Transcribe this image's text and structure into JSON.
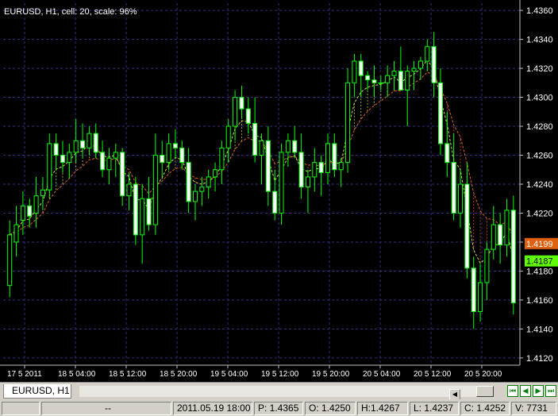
{
  "chart": {
    "header": "EURUSD, H1, cell: 20, scale: 96%",
    "background": "#000000",
    "grid_color": "#2f2f7f",
    "axis_color": "#c0c0c0",
    "bull_color": "#ffffff",
    "bear_color": "#00ff00",
    "price_labels": [
      "1.4360",
      "1.4340",
      "1.4320",
      "1.4300",
      "1.4280",
      "1.4260",
      "1.4240",
      "1.4220",
      "1.4200",
      "1.4180",
      "1.4160",
      "1.4140",
      "1.4120"
    ],
    "time_labels": [
      "17 5 2011",
      "18 5 04:00",
      "18 5 12:00",
      "18 5 20:00",
      "19 5 04:00",
      "19 5 12:00",
      "19 5 20:00",
      "20 5 04:00",
      "20 5 12:00",
      "20 5 20:00"
    ],
    "price_badges": [
      {
        "label": "1.4199",
        "bg": "#e06010",
        "fg": "#ffffff"
      },
      {
        "label": "1.4187",
        "bg": "#60ff00",
        "fg": "#000000"
      }
    ]
  },
  "chart_data": {
    "type": "candlestick",
    "symbol": "EURUSD",
    "timeframe": "H1",
    "ylim": [
      1.4115,
      1.4365
    ],
    "candles": [
      {
        "o": 1.417,
        "h": 1.4215,
        "l": 1.4162,
        "c": 1.4205
      },
      {
        "o": 1.42,
        "h": 1.4225,
        "l": 1.419,
        "c": 1.4212
      },
      {
        "o": 1.4215,
        "h": 1.4235,
        "l": 1.4205,
        "c": 1.4225
      },
      {
        "o": 1.4225,
        "h": 1.423,
        "l": 1.421,
        "c": 1.4218
      },
      {
        "o": 1.422,
        "h": 1.4245,
        "l": 1.421,
        "c": 1.4232
      },
      {
        "o": 1.4232,
        "h": 1.4245,
        "l": 1.4222,
        "c": 1.4236
      },
      {
        "o": 1.4236,
        "h": 1.4275,
        "l": 1.423,
        "c": 1.4268
      },
      {
        "o": 1.4268,
        "h": 1.4275,
        "l": 1.425,
        "c": 1.426
      },
      {
        "o": 1.426,
        "h": 1.427,
        "l": 1.4248,
        "c": 1.4255
      },
      {
        "o": 1.4255,
        "h": 1.4268,
        "l": 1.4244,
        "c": 1.4262
      },
      {
        "o": 1.4262,
        "h": 1.4285,
        "l": 1.4255,
        "c": 1.427
      },
      {
        "o": 1.427,
        "h": 1.4282,
        "l": 1.4258,
        "c": 1.4265
      },
      {
        "o": 1.4265,
        "h": 1.428,
        "l": 1.426,
        "c": 1.4275
      },
      {
        "o": 1.4275,
        "h": 1.4282,
        "l": 1.4258,
        "c": 1.4262
      },
      {
        "o": 1.4262,
        "h": 1.427,
        "l": 1.4245,
        "c": 1.425
      },
      {
        "o": 1.425,
        "h": 1.4265,
        "l": 1.424,
        "c": 1.4258
      },
      {
        "o": 1.4258,
        "h": 1.4268,
        "l": 1.4245,
        "c": 1.4262
      },
      {
        "o": 1.4262,
        "h": 1.4265,
        "l": 1.4225,
        "c": 1.4232
      },
      {
        "o": 1.4232,
        "h": 1.4248,
        "l": 1.4222,
        "c": 1.424
      },
      {
        "o": 1.424,
        "h": 1.4245,
        "l": 1.4198,
        "c": 1.4205
      },
      {
        "o": 1.4205,
        "h": 1.424,
        "l": 1.4185,
        "c": 1.423
      },
      {
        "o": 1.423,
        "h": 1.4245,
        "l": 1.4208,
        "c": 1.4212
      },
      {
        "o": 1.4212,
        "h": 1.4275,
        "l": 1.4205,
        "c": 1.426
      },
      {
        "o": 1.426,
        "h": 1.427,
        "l": 1.4245,
        "c": 1.4255
      },
      {
        "o": 1.4255,
        "h": 1.4275,
        "l": 1.425,
        "c": 1.4268
      },
      {
        "o": 1.4268,
        "h": 1.4278,
        "l": 1.4258,
        "c": 1.4265
      },
      {
        "o": 1.4265,
        "h": 1.427,
        "l": 1.425,
        "c": 1.4255
      },
      {
        "o": 1.4255,
        "h": 1.4265,
        "l": 1.422,
        "c": 1.4228
      },
      {
        "o": 1.4228,
        "h": 1.424,
        "l": 1.4215,
        "c": 1.4235
      },
      {
        "o": 1.4235,
        "h": 1.4245,
        "l": 1.4225,
        "c": 1.4238
      },
      {
        "o": 1.4238,
        "h": 1.425,
        "l": 1.423,
        "c": 1.4245
      },
      {
        "o": 1.4245,
        "h": 1.4255,
        "l": 1.4235,
        "c": 1.425
      },
      {
        "o": 1.425,
        "h": 1.427,
        "l": 1.424,
        "c": 1.4265
      },
      {
        "o": 1.4265,
        "h": 1.4285,
        "l": 1.4255,
        "c": 1.428
      },
      {
        "o": 1.428,
        "h": 1.4305,
        "l": 1.427,
        "c": 1.43
      },
      {
        "o": 1.43,
        "h": 1.4308,
        "l": 1.4285,
        "c": 1.4292
      },
      {
        "o": 1.4292,
        "h": 1.43,
        "l": 1.4275,
        "c": 1.4282
      },
      {
        "o": 1.4282,
        "h": 1.43,
        "l": 1.4255,
        "c": 1.426
      },
      {
        "o": 1.426,
        "h": 1.4275,
        "l": 1.424,
        "c": 1.427
      },
      {
        "o": 1.427,
        "h": 1.428,
        "l": 1.4225,
        "c": 1.4235
      },
      {
        "o": 1.4235,
        "h": 1.425,
        "l": 1.4215,
        "c": 1.422
      },
      {
        "o": 1.422,
        "h": 1.4268,
        "l": 1.4212,
        "c": 1.4262
      },
      {
        "o": 1.4262,
        "h": 1.4275,
        "l": 1.4252,
        "c": 1.427
      },
      {
        "o": 1.427,
        "h": 1.428,
        "l": 1.4258,
        "c": 1.4262
      },
      {
        "o": 1.4262,
        "h": 1.4275,
        "l": 1.423,
        "c": 1.4238
      },
      {
        "o": 1.4238,
        "h": 1.425,
        "l": 1.422,
        "c": 1.4245
      },
      {
        "o": 1.4245,
        "h": 1.4265,
        "l": 1.4235,
        "c": 1.4255
      },
      {
        "o": 1.4255,
        "h": 1.426,
        "l": 1.4232,
        "c": 1.4248
      },
      {
        "o": 1.4248,
        "h": 1.4275,
        "l": 1.424,
        "c": 1.4268
      },
      {
        "o": 1.4268,
        "h": 1.4275,
        "l": 1.4245,
        "c": 1.425
      },
      {
        "o": 1.425,
        "h": 1.4258,
        "l": 1.4238,
        "c": 1.4255
      },
      {
        "o": 1.4255,
        "h": 1.432,
        "l": 1.4248,
        "c": 1.431
      },
      {
        "o": 1.431,
        "h": 1.433,
        "l": 1.43,
        "c": 1.4325
      },
      {
        "o": 1.4325,
        "h": 1.433,
        "l": 1.43,
        "c": 1.4315
      },
      {
        "o": 1.4315,
        "h": 1.4318,
        "l": 1.4305,
        "c": 1.4312
      },
      {
        "o": 1.4312,
        "h": 1.4322,
        "l": 1.43,
        "c": 1.431
      },
      {
        "o": 1.431,
        "h": 1.4315,
        "l": 1.4305,
        "c": 1.431
      },
      {
        "o": 1.431,
        "h": 1.4322,
        "l": 1.43,
        "c": 1.4315
      },
      {
        "o": 1.4315,
        "h": 1.4325,
        "l": 1.4305,
        "c": 1.4318
      },
      {
        "o": 1.4318,
        "h": 1.4335,
        "l": 1.4305,
        "c": 1.4305
      },
      {
        "o": 1.4305,
        "h": 1.4322,
        "l": 1.428,
        "c": 1.4318
      },
      {
        "o": 1.4318,
        "h": 1.4325,
        "l": 1.4305,
        "c": 1.432
      },
      {
        "o": 1.432,
        "h": 1.4328,
        "l": 1.4312,
        "c": 1.4325
      },
      {
        "o": 1.4325,
        "h": 1.434,
        "l": 1.4318,
        "c": 1.4335
      },
      {
        "o": 1.4335,
        "h": 1.4345,
        "l": 1.43,
        "c": 1.431
      },
      {
        "o": 1.431,
        "h": 1.432,
        "l": 1.426,
        "c": 1.4268
      },
      {
        "o": 1.4268,
        "h": 1.429,
        "l": 1.4245,
        "c": 1.4255
      },
      {
        "o": 1.4255,
        "h": 1.4275,
        "l": 1.4215,
        "c": 1.422
      },
      {
        "o": 1.422,
        "h": 1.425,
        "l": 1.421,
        "c": 1.424
      },
      {
        "o": 1.424,
        "h": 1.4255,
        "l": 1.4175,
        "c": 1.4182
      },
      {
        "o": 1.4182,
        "h": 1.419,
        "l": 1.414,
        "c": 1.4152
      },
      {
        "o": 1.4152,
        "h": 1.4185,
        "l": 1.4145,
        "c": 1.4172
      },
      {
        "o": 1.4172,
        "h": 1.42,
        "l": 1.416,
        "c": 1.4195
      },
      {
        "o": 1.4195,
        "h": 1.4225,
        "l": 1.4188,
        "c": 1.4212
      },
      {
        "o": 1.4212,
        "h": 1.422,
        "l": 1.4185,
        "c": 1.4198
      },
      {
        "o": 1.4198,
        "h": 1.423,
        "l": 1.419,
        "c": 1.4222
      },
      {
        "o": 1.4222,
        "h": 1.4232,
        "l": 1.415,
        "c": 1.4158
      }
    ]
  },
  "tabs": [
    {
      "label": "EURUSD, H1"
    }
  ],
  "nav": [
    {
      "icon": "first-page-icon"
    },
    {
      "icon": "prev-page-icon"
    },
    {
      "icon": "next-page-icon"
    },
    {
      "icon": "last-page-icon"
    }
  ],
  "status": {
    "left": "",
    "mode": "--",
    "datetime": "2011.05.19 18:00",
    "p": "P: 1.4365",
    "o": "O: 1.4250",
    "h": "H:1.4267",
    "l": "L: 1.4237",
    "c": "C: 1.4252",
    "v": "V: 7731"
  }
}
